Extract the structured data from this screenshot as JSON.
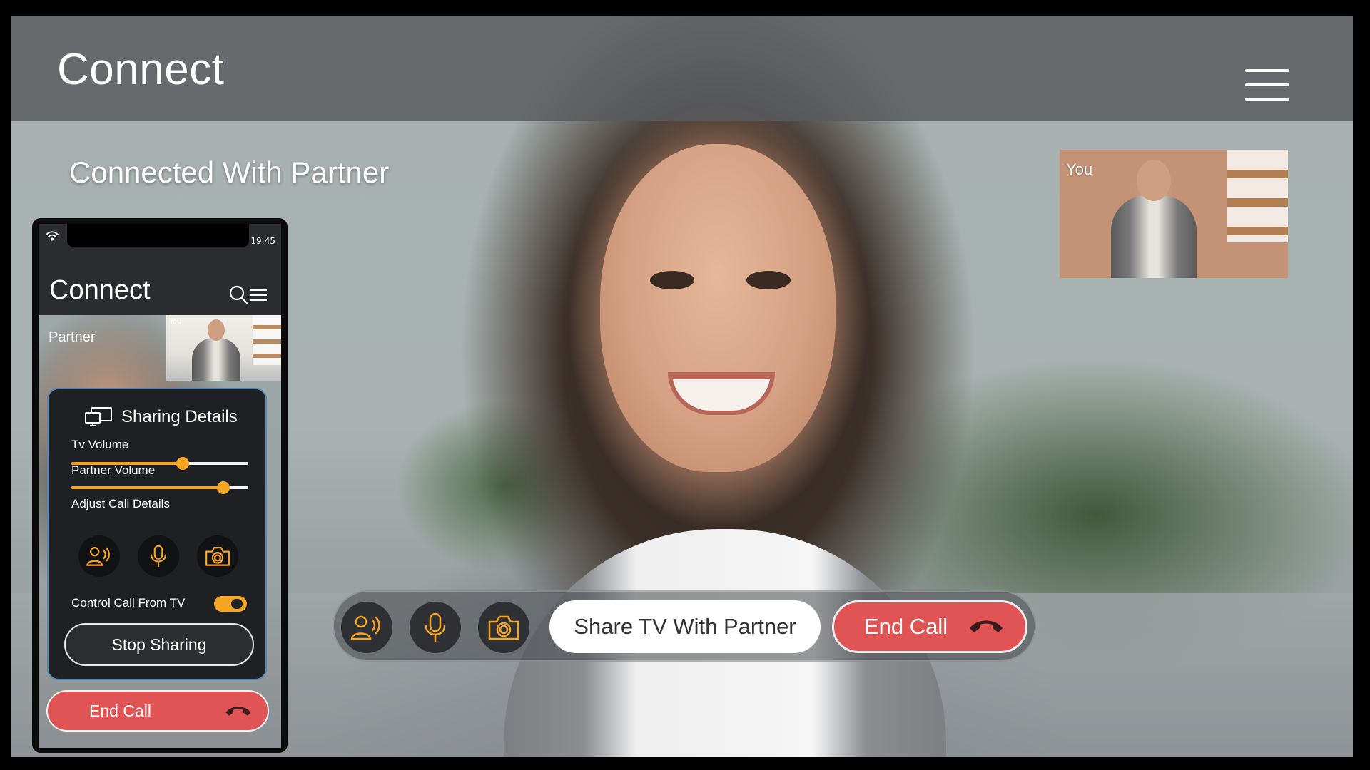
{
  "header": {
    "title": "Connect"
  },
  "call": {
    "status": "Connected With Partner",
    "self_label": "You"
  },
  "controls": {
    "icons": [
      "speaker-person-icon",
      "microphone-icon",
      "camera-icon"
    ],
    "share_label": "Share TV With Partner",
    "end_label": "End Call"
  },
  "phone": {
    "time": "19:45",
    "title": "Connect",
    "partner_label": "Partner",
    "self_label": "You",
    "panel": {
      "title": "Sharing Details",
      "tv_volume_label": "Tv Volume",
      "tv_volume": 0.63,
      "partner_volume_label": "Partner Volume",
      "partner_volume": 0.86,
      "adjust_label": "Adjust Call Details",
      "control_label": "Control Call From TV",
      "control_enabled": true,
      "stop_label": "Stop Sharing"
    },
    "end_label": "End Call"
  },
  "colors": {
    "accent": "#f5a524",
    "end_call": "#e05456",
    "panel": "#1f2023"
  }
}
